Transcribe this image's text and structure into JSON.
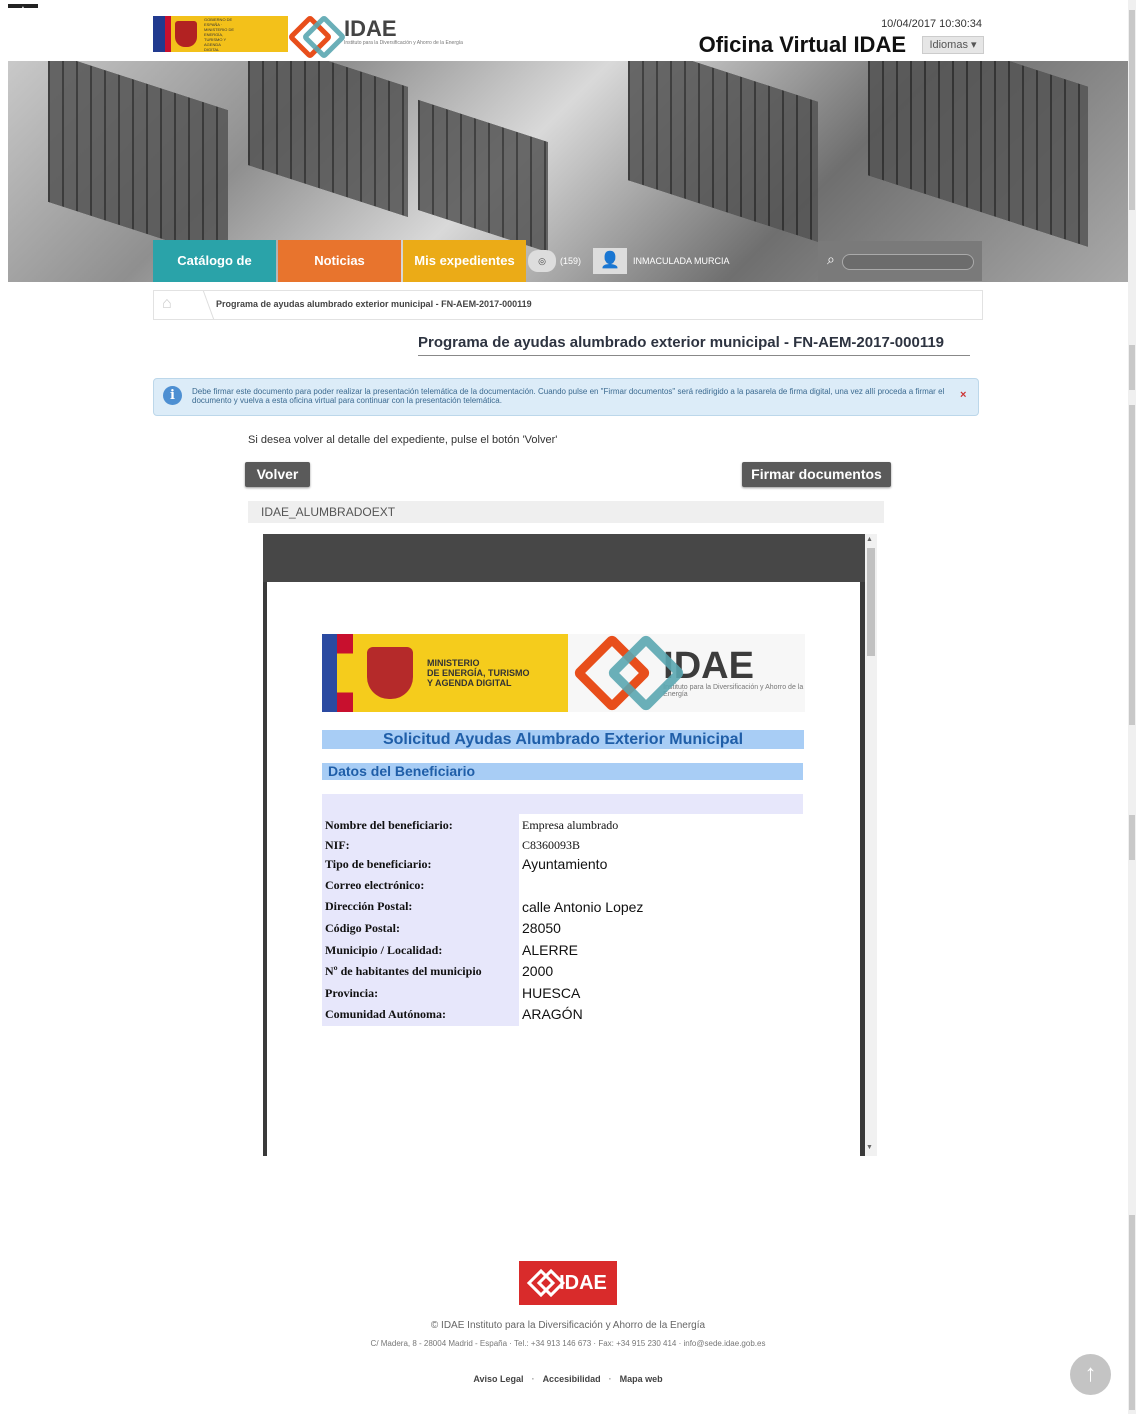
{
  "header": {
    "gov_logo_text": "GOBIERNO DE ESPAÑA · MINISTERIO DE ENERGÍA, TURISMO Y AGENDA DIGITAL",
    "idae_logo_text": "IDAE",
    "idae_logo_sub": "Instituto para la Diversificación y Ahorro de la Energía",
    "datetime": "10/04/2017 10:30:34",
    "site_title": "Oficina Virtual IDAE",
    "language_button": "Idiomas"
  },
  "nav": {
    "tabs": [
      {
        "label": "Catálogo de trámites",
        "color": "#2aa3a9"
      },
      {
        "label": "Noticias",
        "color": "#e8742d"
      },
      {
        "label": "Mis expedientes",
        "color": "#ebab17"
      }
    ],
    "notifications_count": "(159)",
    "user_name": "INMACULADA MURCIA"
  },
  "breadcrumb": {
    "current": "Programa de ayudas alumbrado exterior municipal - FN-AEM-2017-000119"
  },
  "page": {
    "title": "Programa de ayudas alumbrado exterior municipal - FN-AEM-2017-000119",
    "alert_text": "Debe firmar este documento para poder realizar la presentación telemática de la documentación. Cuando pulse en \"Firmar documentos\" será redirigido a la pasarela de firma digital, una vez allí proceda a firmar el documento y vuelva a esta oficina virtual para continuar con la presentación telemática.",
    "alert_close": "×",
    "info_line": "Si desea volver al detalle del expediente, pulse el botón 'Volver'",
    "back_button": "Volver",
    "sign_button": "Firmar documentos",
    "document_name": "IDAE_ALUMBRADOEXT"
  },
  "document": {
    "gov_text": "MINISTERIO\nDE ENERGÍA, TURISMO\nY AGENDA DIGITAL",
    "idae_name": "IDAE",
    "idae_sub": "Instituto para la Diversificación y Ahorro de la Energía",
    "heading": "Solicitud Ayudas Alumbrado Exterior Municipal",
    "section": "Datos del Beneficiario",
    "rows": [
      {
        "label": "Nombre del beneficiario:",
        "value": "Empresa alumbrado"
      },
      {
        "label": "NIF:",
        "value": "C8360093B"
      },
      {
        "label": "Tipo de beneficiario:",
        "value": "Ayuntamiento"
      },
      {
        "label": "Correo electrónico:",
        "value": ""
      },
      {
        "label": "Dirección Postal:",
        "value": "calle Antonio Lopez"
      },
      {
        "label": "Código Postal:",
        "value": "28050"
      },
      {
        "label": "Municipio / Localidad:",
        "value": "ALERRE"
      },
      {
        "label": "Nº de habitantes del municipio",
        "value": "2000"
      },
      {
        "label": "Provincia:",
        "value": "HUESCA"
      },
      {
        "label": "Comunidad Autónoma:",
        "value": "ARAGÓN"
      }
    ]
  },
  "footer": {
    "logo_text": "IDAE",
    "copyright": "© IDAE Instituto para la Diversificación y Ahorro de la Energía",
    "address": "C/ Madera, 8 - 28004 Madrid - España   ·   Tel.: +34 913 146 673   ·   Fax: +34 915 230 414   ·   info@sede.idae.gob.es",
    "links": [
      "Aviso Legal",
      "Accesibilidad",
      "Mapa web"
    ]
  }
}
